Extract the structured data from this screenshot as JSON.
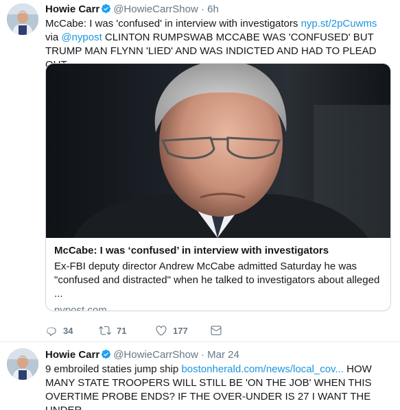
{
  "tweets": [
    {
      "name": "Howie Carr",
      "handle": "@HowieCarrShow",
      "separator": "·",
      "time": "6h",
      "text_part1": "McCabe: I was 'confused' in interview with investigators ",
      "link1": "nyp.st/2pCuwms",
      "text_part2": " via ",
      "mention": "@nypost",
      "text_part3": " CLINTON RUMPSWAB MCCABE WAS 'CONFUSED' BUT TRUMP MAN FLYNN 'LIED' AND WAS INDICTED AND HAD TO PLEAD OUT....",
      "card": {
        "title": "McCabe: I was ‘confused’ in interview with investigators",
        "description": "Ex-FBI deputy director Andrew McCabe admitted Saturday he was \"confused and distracted\" when he talked to investigators about alleged ...",
        "domain": "nypost.com"
      },
      "actions": {
        "replies": "34",
        "retweets": "71",
        "likes": "177"
      }
    },
    {
      "name": "Howie Carr",
      "handle": "@HowieCarrShow",
      "separator": "·",
      "time": "Mar 24",
      "text_part1": "9 embroiled staties jump ship ",
      "link1": "bostonherald.com/news/local_cov...",
      "text_part2": " HOW MANY STATE TROOPERS WILL STILL BE 'ON THE JOB' WHEN THIS OVERTIME PROBE ENDS? IF THE OVER-UNDER IS 27 I WANT THE UNDER."
    }
  ],
  "colors": {
    "link": "#1b95e0",
    "secondary": "#657786",
    "verified": "#1da1f2",
    "border": "#e6ecf0"
  },
  "icons": [
    "verified-badge-icon",
    "reply-icon",
    "retweet-icon",
    "like-icon",
    "direct-message-icon"
  ]
}
